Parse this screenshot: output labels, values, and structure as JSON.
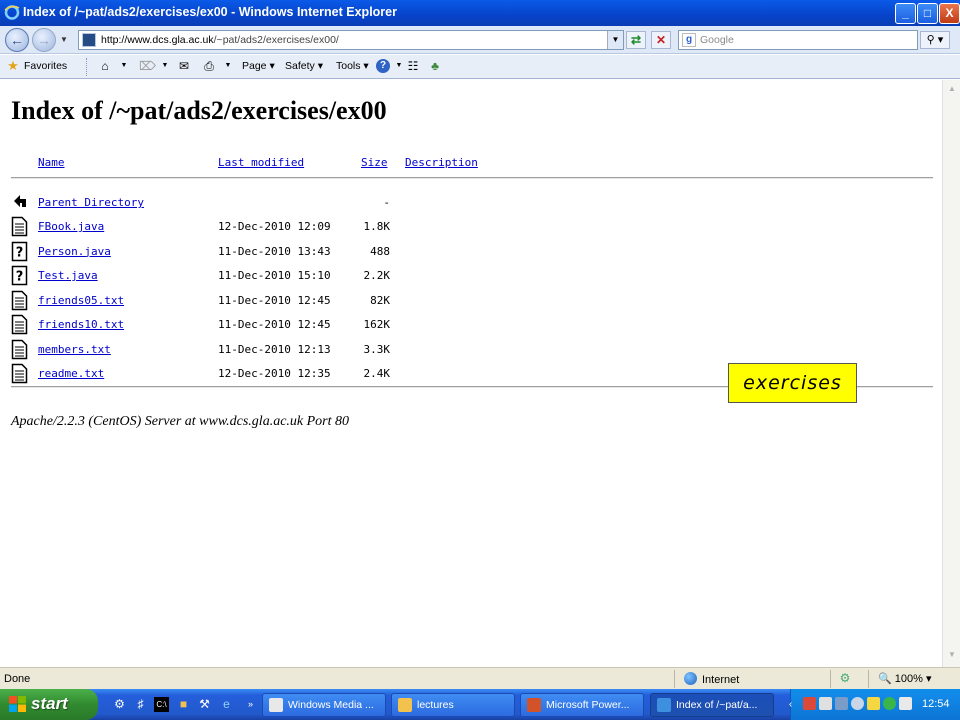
{
  "window": {
    "title": "Index of /~pat/ads2/exercises/ex00 - Windows Internet Explorer",
    "minimize": "_",
    "maximize": "□",
    "close": "X"
  },
  "address": {
    "url_host": "http://www.dcs.gla.ac.uk",
    "url_path": "/~pat/ads2/exercises/ex00/",
    "search_placeholder": "Google"
  },
  "command_bar": {
    "favorites": "Favorites",
    "page": "Page",
    "safety": "Safety",
    "tools": "Tools"
  },
  "listing": {
    "title": "Index of /~pat/ads2/exercises/ex00",
    "headers": {
      "name": "Name",
      "last_modified": "Last modified",
      "size": "Size",
      "description": "Description"
    },
    "parent": {
      "name": "Parent Directory",
      "size": "-"
    },
    "files": [
      {
        "name": "FBook.java",
        "date": "12-Dec-2010 12:09",
        "size": "1.8K",
        "icon": "text-file-icon"
      },
      {
        "name": "Person.java",
        "date": "11-Dec-2010 13:43",
        "size": "488",
        "icon": "unknown-file-icon"
      },
      {
        "name": "Test.java",
        "date": "11-Dec-2010 15:10",
        "size": "2.2K",
        "icon": "unknown-file-icon"
      },
      {
        "name": "friends05.txt",
        "date": "11-Dec-2010 12:45",
        "size": "82K",
        "icon": "text-file-icon"
      },
      {
        "name": "friends10.txt",
        "date": "11-Dec-2010 12:45",
        "size": "162K",
        "icon": "text-file-icon"
      },
      {
        "name": "members.txt",
        "date": "11-Dec-2010 12:13",
        "size": "3.3K",
        "icon": "text-file-icon"
      },
      {
        "name": "readme.txt",
        "date": "12-Dec-2010 12:35",
        "size": "2.4K",
        "icon": "text-file-icon"
      }
    ],
    "server_signature": "Apache/2.2.3 (CentOS) Server at www.dcs.gla.ac.uk Port 80"
  },
  "callout": {
    "text": "exercises"
  },
  "status": {
    "text": "Done",
    "zone": "Internet",
    "zoom": "100%"
  },
  "taskbar": {
    "start": "start",
    "tasks": [
      {
        "label": "Windows Media ...",
        "color": "#e8e8e8"
      },
      {
        "label": "lectures",
        "color": "#f2c14e"
      },
      {
        "label": "Microsoft Power...",
        "color": "#d2532a"
      },
      {
        "label": "Index of /~pat/a...",
        "color": "#3d8fe0"
      }
    ],
    "clock": "12:54"
  },
  "colors": {
    "link": "#0000cc",
    "titlebar": "#0743c9",
    "callout": "#ffff00"
  }
}
